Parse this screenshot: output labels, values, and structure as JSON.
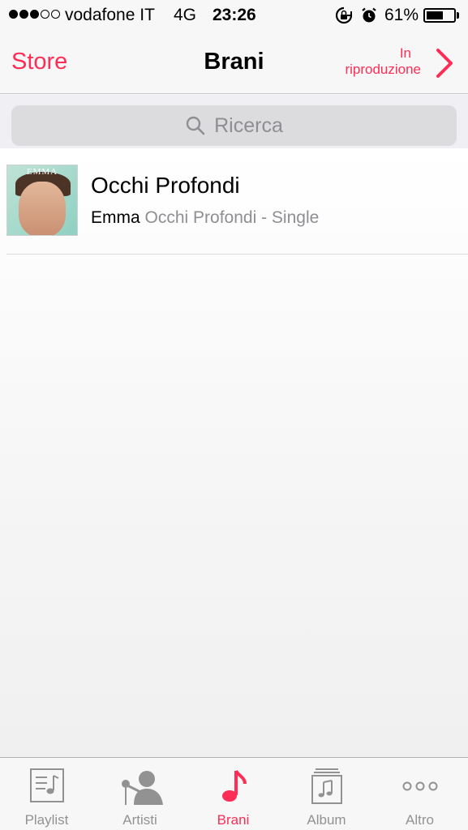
{
  "status_bar": {
    "carrier": "vodafone IT",
    "network": "4G",
    "time": "23:26",
    "battery_percent": "61%",
    "battery_level": 0.61,
    "signal_bars_filled": 3,
    "signal_bars_total": 5
  },
  "nav": {
    "back_label": "Store",
    "title": "Brani",
    "now_playing_line1": "In",
    "now_playing_line2": "riproduzione"
  },
  "search": {
    "placeholder": "Ricerca"
  },
  "songs": [
    {
      "title": "Occhi Profondi",
      "artist": "Emma",
      "album": "Occhi Profondi - Single",
      "artwork_text": "EMMA"
    }
  ],
  "tabs": [
    {
      "label": "Playlist",
      "icon": "playlist-icon",
      "active": false
    },
    {
      "label": "Artisti",
      "icon": "artist-icon",
      "active": false
    },
    {
      "label": "Brani",
      "icon": "music-note-icon",
      "active": true
    },
    {
      "label": "Album",
      "icon": "album-icon",
      "active": false
    },
    {
      "label": "Altro",
      "icon": "more-icon",
      "active": false
    }
  ],
  "colors": {
    "accent": "#ff2d55",
    "inactive": "#929292"
  }
}
